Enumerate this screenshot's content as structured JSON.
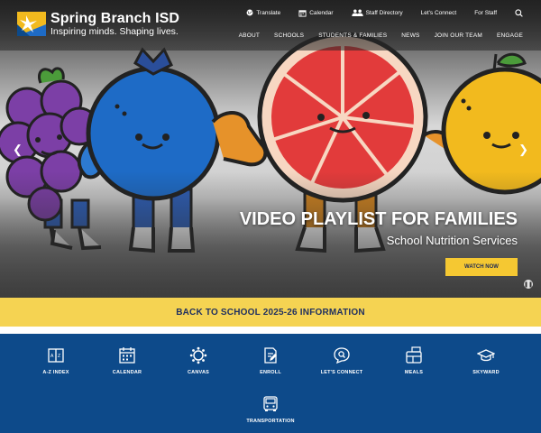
{
  "header": {
    "brand_name": "Spring Branch ISD",
    "tagline": "Inspiring minds. Shaping lives.",
    "utility": [
      {
        "label": "Translate",
        "icon": "globe-icon"
      },
      {
        "label": "Calendar",
        "icon": "calendar-icon"
      },
      {
        "label": "Staff Directory",
        "icon": "people-icon"
      },
      {
        "label": "Let's Connect",
        "icon": ""
      },
      {
        "label": "For Staff",
        "icon": ""
      }
    ],
    "search_icon": "search-icon",
    "nav": [
      "ABOUT",
      "SCHOOLS",
      "STUDENTS & FAMILIES",
      "NEWS",
      "JOIN OUR TEAM",
      "ENGAGE"
    ]
  },
  "hero": {
    "title": "VIDEO PLAYLIST FOR FAMILIES",
    "subtitle": "School Nutrition Services",
    "button": "WATCH NOW",
    "prev_icon": "chevron-left-icon",
    "next_icon": "chevron-right-icon",
    "pause_icon": "pause-icon"
  },
  "banner": {
    "label": "BACK TO SCHOOL 2025-26 INFORMATION"
  },
  "quick_links": [
    {
      "label": "A-Z INDEX",
      "icon": "book-icon"
    },
    {
      "label": "CALENDAR",
      "icon": "calendar-icon"
    },
    {
      "label": "CANVAS",
      "icon": "canvas-icon"
    },
    {
      "label": "ENROLL",
      "icon": "document-edit-icon"
    },
    {
      "label": "LET'S CONNECT",
      "icon": "chat-search-icon"
    },
    {
      "label": "MEALS",
      "icon": "meal-tray-icon"
    },
    {
      "label": "SKYWARD",
      "icon": "graduation-cap-icon"
    },
    {
      "label": "TRANSPORTATION",
      "icon": "bus-icon"
    }
  ],
  "colors": {
    "banner": "#f5d352",
    "quick_links_bg": "#0d4a8a",
    "button": "#f5c832",
    "banner_text": "#203060"
  }
}
